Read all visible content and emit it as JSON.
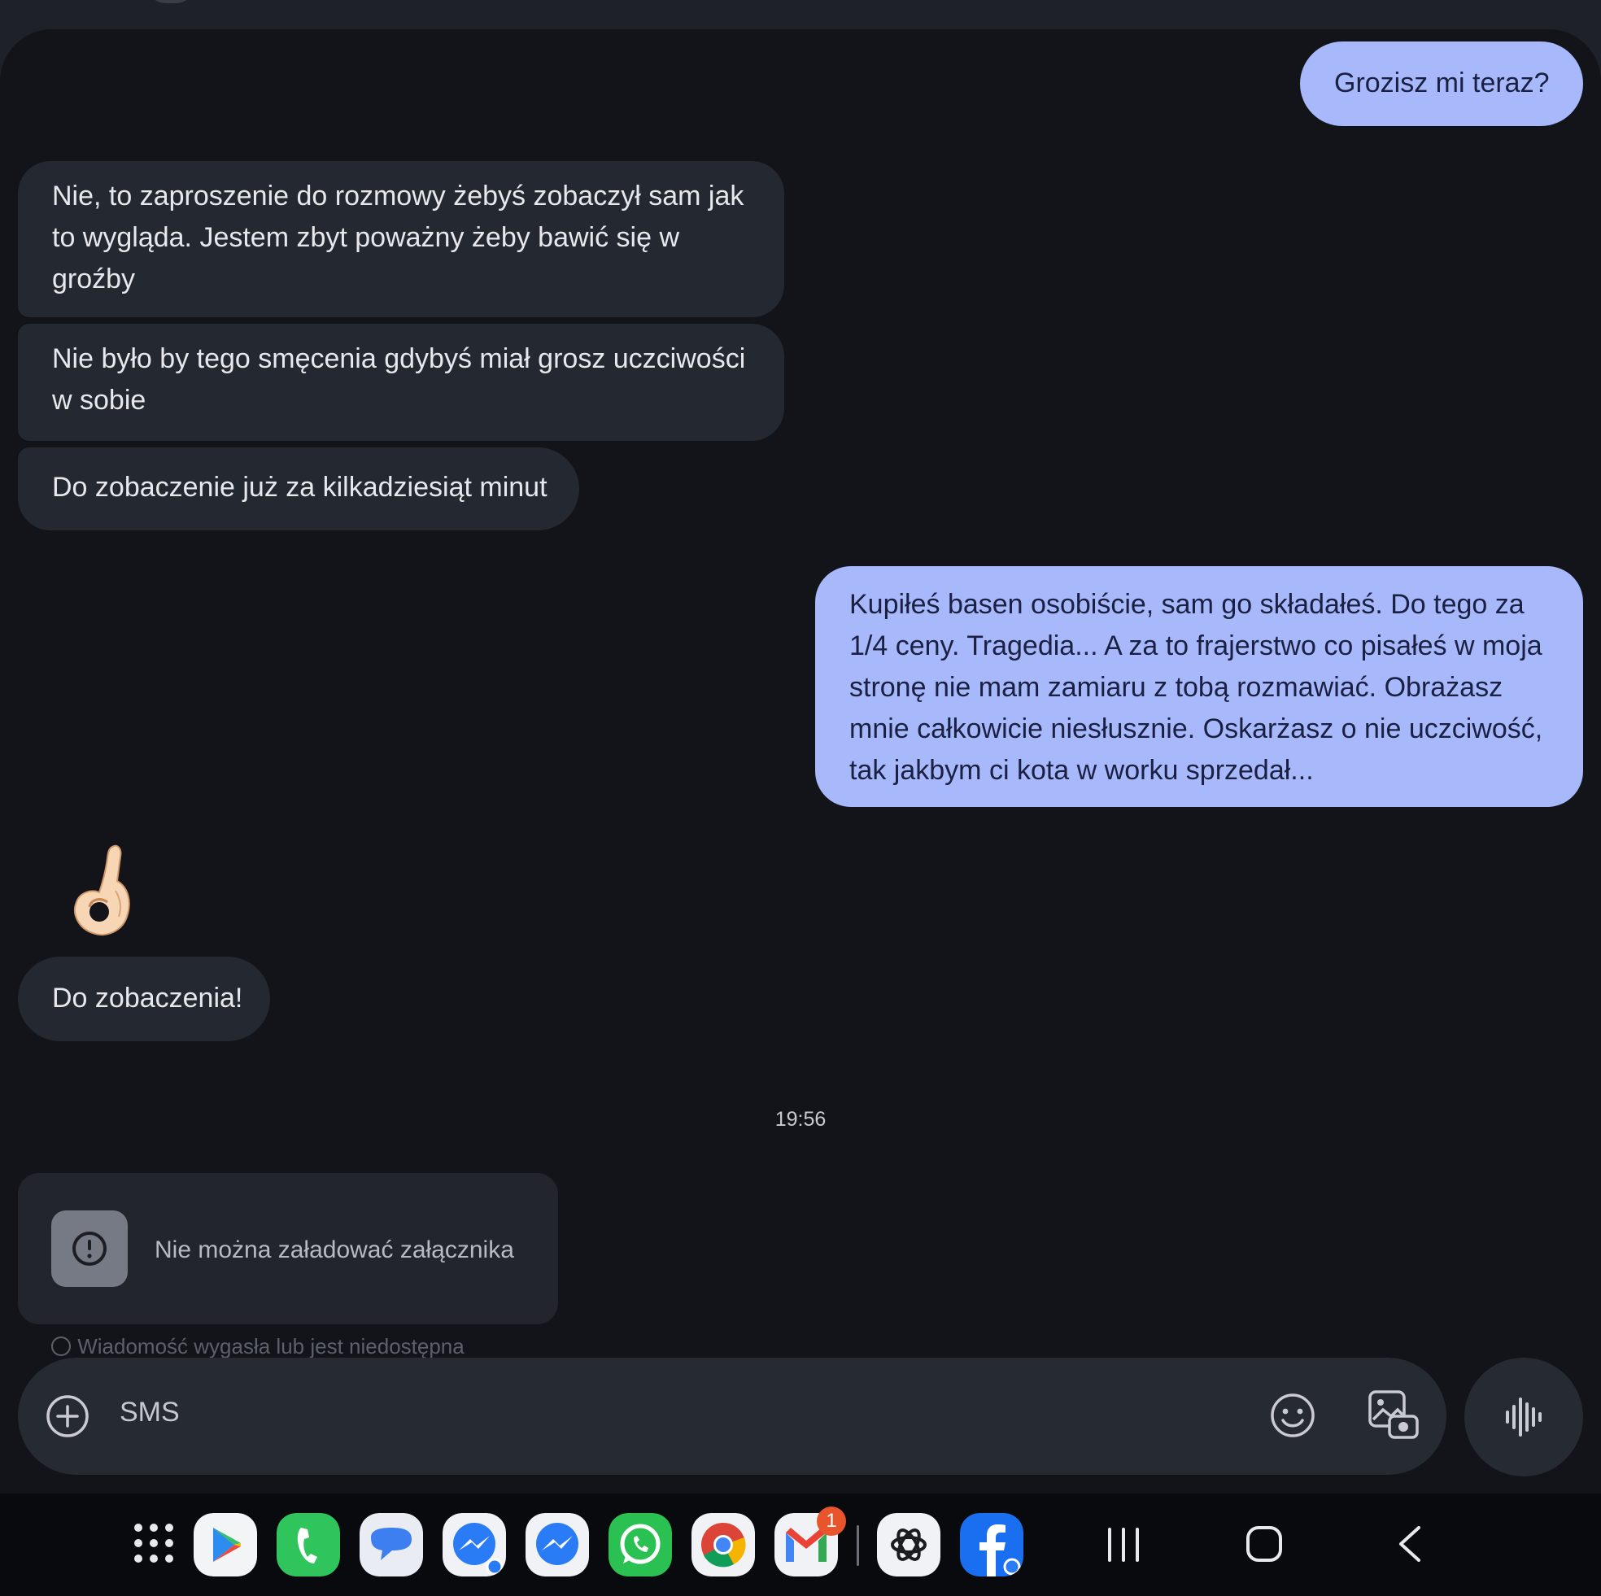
{
  "messages": [
    {
      "dir": "out",
      "text": "Grozisz mi teraz?"
    },
    {
      "dir": "in",
      "text": "Nie, to zaproszenie do rozmowy żebyś zobaczył sam jak to wygląda. Jestem zbyt poważny żeby bawić się w groźby"
    },
    {
      "dir": "in",
      "text": "Nie było by tego smęcenia gdybyś miał grosz uczciwości w sobie"
    },
    {
      "dir": "in",
      "text": "Do zobaczenie już za kilkadziesiąt minut"
    },
    {
      "dir": "out",
      "text": "Kupiłeś basen osobiście, sam go składałeś. Do tego za 1/4 ceny. Tragedia... A za to frajerstwo co pisałeś w moja stronę nie mam zamiaru z tobą rozmawiać. Obrażasz mnie całkowicie niesłusznie. Oskarżasz o nie uczciwość, tak jakbym ci kota w worku sprzedał..."
    },
    {
      "dir": "in",
      "emoji": "ok-hand"
    },
    {
      "dir": "in",
      "text": "Do zobaczenia!"
    }
  ],
  "timestamp": "19:56",
  "attachment": {
    "error_text": "Nie można załadować załącznika",
    "icon": "alert-circle-icon"
  },
  "expired_notice": "Wiadomość wygasła lub jest niedostępna",
  "composer": {
    "placeholder": "SMS",
    "icons": [
      "add-icon",
      "emoji-icon",
      "gallery-icon",
      "voice-icon"
    ]
  },
  "taskbar": {
    "apps": [
      "app-drawer",
      "play-store",
      "phone",
      "messages",
      "messenger",
      "messenger",
      "whatsapp",
      "chrome",
      "gmail",
      "chatgpt",
      "facebook"
    ],
    "gmail_badge": "1",
    "nav": [
      "recents",
      "home",
      "back"
    ]
  },
  "colors": {
    "outgoing_bubble": "#a8b9fb",
    "incoming_bubble": "#242831",
    "background": "#12141a"
  }
}
